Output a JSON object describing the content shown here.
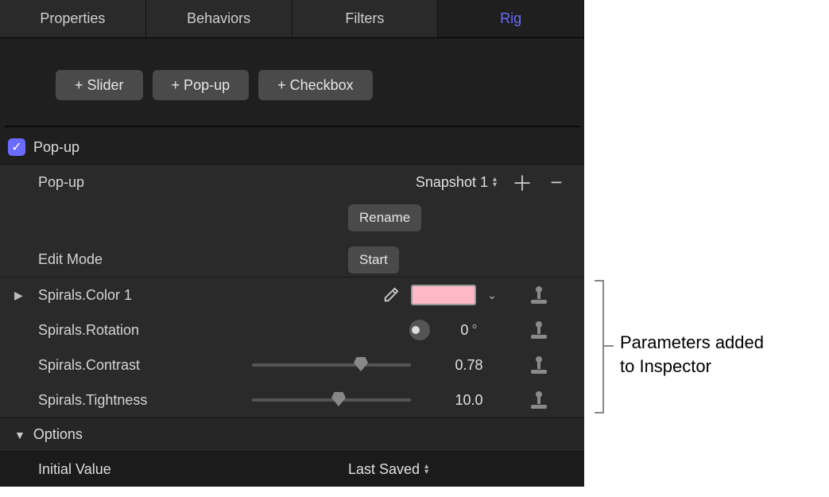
{
  "tabs": {
    "properties": "Properties",
    "behaviors": "Behaviors",
    "filters": "Filters",
    "rig": "Rig"
  },
  "addButtons": {
    "slider": "+ Slider",
    "popup": "+ Pop-up",
    "checkbox": "+ Checkbox"
  },
  "section": {
    "title": "Pop-up",
    "checked": true
  },
  "popupRow": {
    "label": "Pop-up",
    "value": "Snapshot 1",
    "rename": "Rename"
  },
  "editMode": {
    "label": "Edit Mode",
    "button": "Start"
  },
  "params": {
    "color": {
      "label": "Spirals.Color 1",
      "swatch": "#ffb8c6"
    },
    "rotation": {
      "label": "Spirals.Rotation",
      "value": "0",
      "unit": "°"
    },
    "contrast": {
      "label": "Spirals.Contrast",
      "value": "0.78",
      "thumbPct": 64
    },
    "tightness": {
      "label": "Spirals.Tightness",
      "value": "10.0",
      "thumbPct": 50
    }
  },
  "options": {
    "header": "Options",
    "initial": {
      "label": "Initial Value",
      "value": "Last Saved"
    }
  },
  "callout": {
    "line1": "Parameters added",
    "line2": "to Inspector"
  }
}
